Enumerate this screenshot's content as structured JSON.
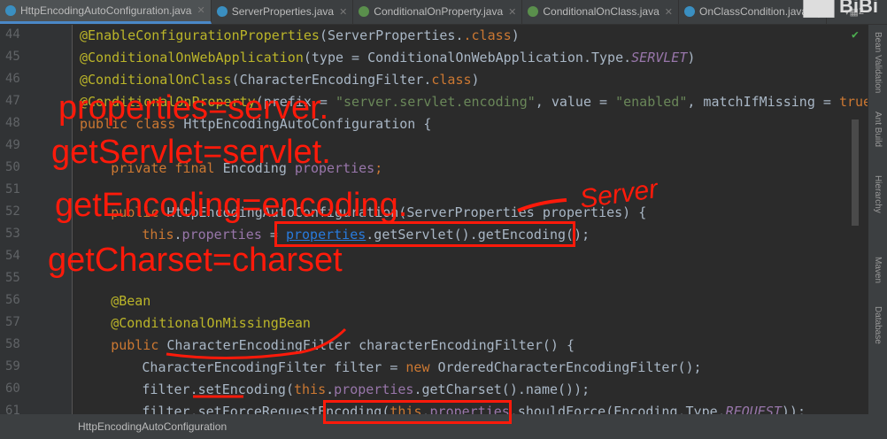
{
  "tabs": [
    {
      "label": "HttpEncodingAutoConfiguration.java",
      "active": true
    },
    {
      "label": "ServerProperties.java"
    },
    {
      "label": "ConditionalOnProperty.java"
    },
    {
      "label": "ConditionalOnClass.java"
    },
    {
      "label": "OnClassCondition.java"
    }
  ],
  "tab_overflow": "2",
  "line_numbers": [
    "44",
    "45",
    "46",
    "47",
    "48",
    "49",
    "50",
    "51",
    "52",
    "53",
    "54",
    "55",
    "56",
    "57",
    "58",
    "59",
    "60",
    "61"
  ],
  "code": {
    "l44": [
      "@EnableConfigurationProperties",
      "(ServerProperties.",
      ".class",
      ")"
    ],
    "l45": [
      "@ConditionalOnWebApplication",
      "(type = ConditionalOnWebApplication.Type.",
      "SERVLET",
      ")"
    ],
    "l46": [
      "@ConditionalOnClass",
      "(CharacterEncodingFilter.",
      "class",
      ")"
    ],
    "l47": [
      "@ConditionalOnProperty",
      "(prefix = ",
      "\"server.servlet.encoding\"",
      ", value = ",
      "\"enabled\"",
      ", matchIfMissing = ",
      "true",
      ")"
    ],
    "l48": [
      "public class ",
      "HttpEncodingAutoConfiguration {"
    ],
    "l50": [
      "private final ",
      "Encoding ",
      "properties",
      ";"
    ],
    "l52": [
      "public ",
      "HttpEncodingAutoConfiguration(ServerProperties properties) {"
    ],
    "l53": [
      "this",
      ".",
      "properties",
      " = ",
      "properties",
      ".getServlet().getEncoding();"
    ],
    "l56": [
      "@Bean"
    ],
    "l57": [
      "@ConditionalOnMissingBean"
    ],
    "l58": [
      "public ",
      "CharacterEncodingFilter characterEncodingFilter() {"
    ],
    "l59": [
      "CharacterEncodingFilter filter = ",
      "new ",
      "OrderedCharacterEncodingFilter();"
    ],
    "l60": [
      "filter.setEncoding(",
      "this",
      ".",
      "properties",
      ".getCharset().name());"
    ],
    "l61": [
      "filter.setForceRequestEncoding(",
      "this",
      ".",
      "properties",
      ".shouldForce(Encoding.Type.",
      "REQUEST",
      "));"
    ]
  },
  "annotations": [
    "properties=server.",
    "getServlet=servlet.",
    "getEncoding=encoding.",
    "getCharset=charset",
    "Server"
  ],
  "right_sidebar": [
    "Bean Validation",
    "Ant Build",
    "Hierarchy",
    "Maven",
    "Database"
  ],
  "status": {
    "breadcrumb": "HttpEncodingAutoConfiguration"
  },
  "watermark": "BiliBili"
}
